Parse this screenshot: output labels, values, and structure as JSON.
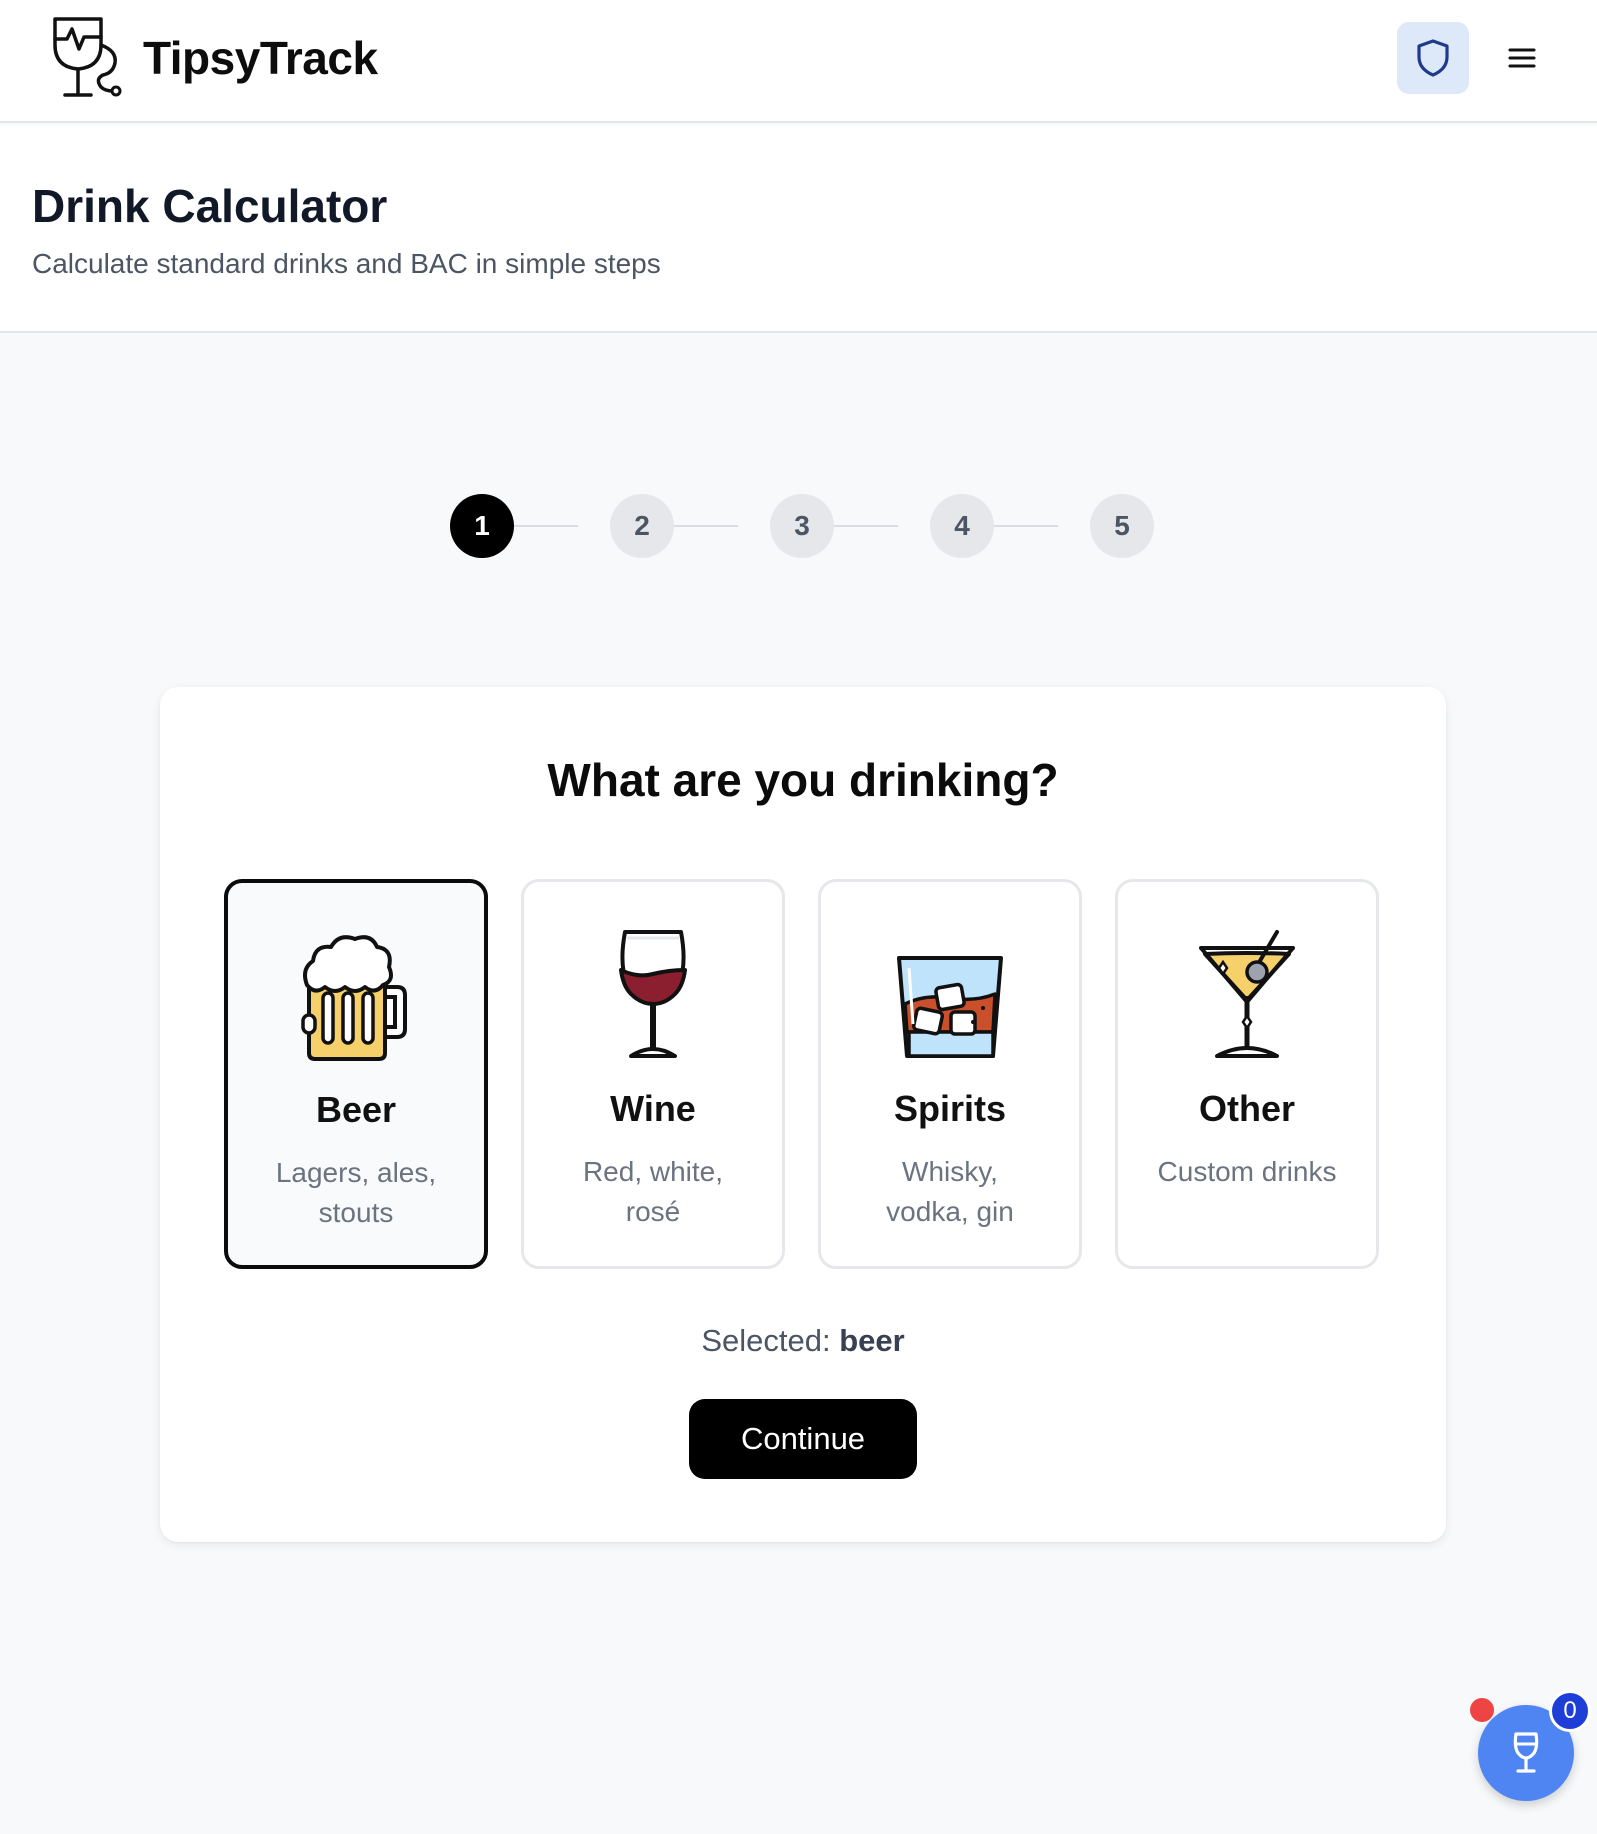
{
  "header": {
    "brand": "TipsyTrack",
    "logo_icon": "wine-glass-heartbeat-icon",
    "shield_icon": "shield-icon",
    "menu_icon": "hamburger-menu-icon",
    "accent_color": "#dde8f8"
  },
  "page": {
    "title": "Drink Calculator",
    "subtitle": "Calculate standard drinks and BAC in simple steps"
  },
  "stepper": {
    "steps": [
      "1",
      "2",
      "3",
      "4",
      "5"
    ],
    "current": 1
  },
  "card": {
    "question": "What are you drinking?",
    "options": [
      {
        "name": "Beer",
        "desc": "Lagers, ales, stouts",
        "icon": "beer-mug-icon",
        "selected": true
      },
      {
        "name": "Wine",
        "desc": "Red, white, rosé",
        "icon": "wine-glass-icon",
        "selected": false
      },
      {
        "name": "Spirits",
        "desc": "Whisky, vodka, gin",
        "icon": "whisky-glass-icon",
        "selected": false
      },
      {
        "name": "Other",
        "desc": "Custom drinks",
        "icon": "cocktail-glass-icon",
        "selected": false
      }
    ],
    "selected_label": "Selected:",
    "selected_value": "beer",
    "continue_label": "Continue"
  },
  "fab": {
    "icon": "glass-icon",
    "badge_count": "0",
    "color": "#4f84f3"
  }
}
